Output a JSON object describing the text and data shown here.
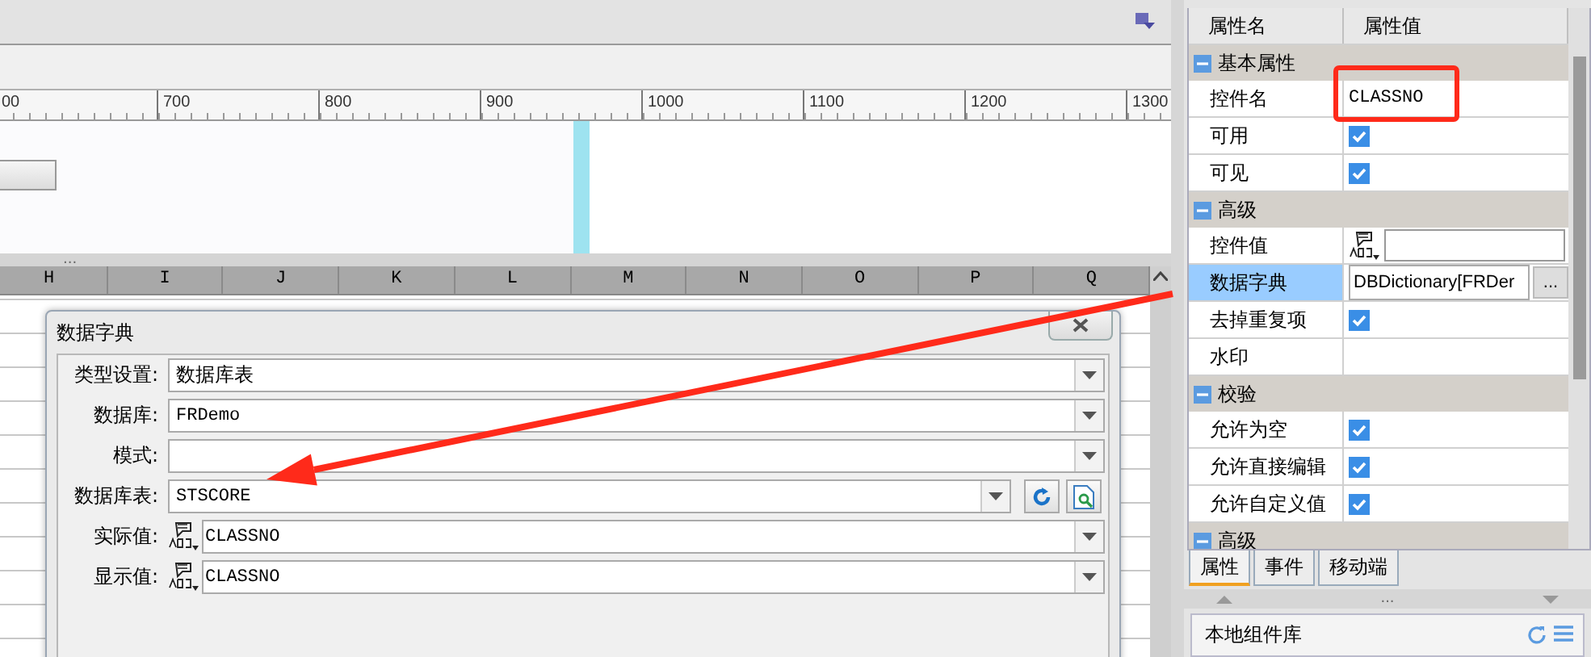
{
  "ruler": {
    "labels": [
      "00",
      "700",
      "800",
      "900",
      "1000",
      "1100",
      "1200",
      "1300"
    ]
  },
  "spreadsheet": {
    "columns": [
      "H",
      "I",
      "J",
      "K",
      "L",
      "M",
      "N",
      "O",
      "P",
      "Q"
    ]
  },
  "dialog": {
    "title": "数据字典",
    "fields": [
      {
        "label": "类型设置:",
        "value": "数据库表",
        "kind": "select"
      },
      {
        "label": "数据库:",
        "value": "FRDemo",
        "kind": "select"
      },
      {
        "label": "模式:",
        "kind": "select"
      },
      {
        "label": "数据库表:",
        "value": "STSCORE",
        "kind": "table_select"
      },
      {
        "label": "实际值:",
        "value": "CLASSNO",
        "kind": "column_select"
      },
      {
        "label": "显示值:",
        "value": "CLASSNO",
        "kind": "column_select"
      }
    ]
  },
  "property_panel": {
    "columns": [
      "属性名",
      "属性值"
    ],
    "groups": [
      {
        "name": "基本属性",
        "expanded": true,
        "rows": [
          {
            "name": "控件名",
            "kind": "text",
            "value": "CLASSNO",
            "selected": false
          },
          {
            "name": "可用",
            "kind": "checkbox",
            "checked": true,
            "selected": false
          },
          {
            "name": "可见",
            "kind": "checkbox",
            "checked": true,
            "selected": false
          }
        ]
      },
      {
        "name": "高级",
        "expanded": true,
        "rows": [
          {
            "name": "控件值",
            "kind": "typed_input",
            "selected": false
          },
          {
            "name": "数据字典",
            "kind": "dictionary",
            "value": "DBDictionary[FRDer",
            "button_label": "...",
            "selected": true
          },
          {
            "name": "去掉重复项",
            "kind": "checkbox",
            "checked": true,
            "selected": false
          },
          {
            "name": "水印",
            "kind": "empty",
            "selected": false
          }
        ]
      },
      {
        "name": "校验",
        "expanded": true,
        "rows": [
          {
            "name": "允许为空",
            "kind": "checkbox",
            "checked": true,
            "selected": false
          },
          {
            "name": "允许直接编辑",
            "kind": "checkbox",
            "checked": true,
            "selected": false
          },
          {
            "name": "允许自定义值",
            "kind": "checkbox",
            "checked": true,
            "selected": false
          }
        ]
      },
      {
        "name": "高级",
        "expanded": true
      }
    ]
  },
  "tabs": [
    {
      "label": "属性",
      "selected": true
    },
    {
      "label": "事件",
      "selected": false
    },
    {
      "label": "移动端",
      "selected": false
    }
  ],
  "splitter": {
    "label": "..."
  },
  "bottom_splitter": {
    "label": "..."
  },
  "component_library": {
    "title": "本地组件库"
  }
}
